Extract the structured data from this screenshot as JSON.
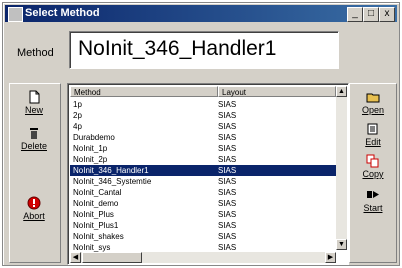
{
  "window": {
    "title": "Select Method",
    "controls": {
      "minimize": "_",
      "maximize": "□",
      "close": "x"
    }
  },
  "method": {
    "label": "Method",
    "value": "NoInit_346_Handler1"
  },
  "left_buttons": [
    {
      "label": "New",
      "icon": "new-document-icon"
    },
    {
      "label": "Delete",
      "icon": "trash-icon"
    },
    {
      "label": "Abort",
      "icon": "abort-icon"
    }
  ],
  "right_buttons": [
    {
      "label": "Open",
      "icon": "open-folder-icon"
    },
    {
      "label": "Edit",
      "icon": "edit-icon"
    },
    {
      "label": "Copy",
      "icon": "copy-icon"
    },
    {
      "label": "Start",
      "icon": "start-icon"
    }
  ],
  "list": {
    "columns": [
      "Method",
      "Layout"
    ],
    "selected_index": 6,
    "rows": [
      {
        "method": "1p",
        "layout": "SIAS"
      },
      {
        "method": "2p",
        "layout": "SIAS"
      },
      {
        "method": "4p",
        "layout": "SIAS"
      },
      {
        "method": "Durabdemo",
        "layout": "SIAS"
      },
      {
        "method": "NoInit_1p",
        "layout": "SIAS"
      },
      {
        "method": "NoInit_2p",
        "layout": "SIAS"
      },
      {
        "method": "NoInit_346_Handler1",
        "layout": "SIAS"
      },
      {
        "method": "NoInit_346_Systemtie",
        "layout": "SIAS"
      },
      {
        "method": "NoInit_Cantal",
        "layout": "SIAS"
      },
      {
        "method": "NoInit_demo",
        "layout": "SIAS"
      },
      {
        "method": "NoInit_Plus",
        "layout": "SIAS"
      },
      {
        "method": "NoInit_Plus1",
        "layout": "SIAS"
      },
      {
        "method": "NoInit_shakes",
        "layout": "SIAS"
      },
      {
        "method": "NoInit_sys",
        "layout": "SIAS"
      }
    ]
  },
  "colors": {
    "selection": "#0a246a",
    "titlebar": "#0a246a"
  }
}
